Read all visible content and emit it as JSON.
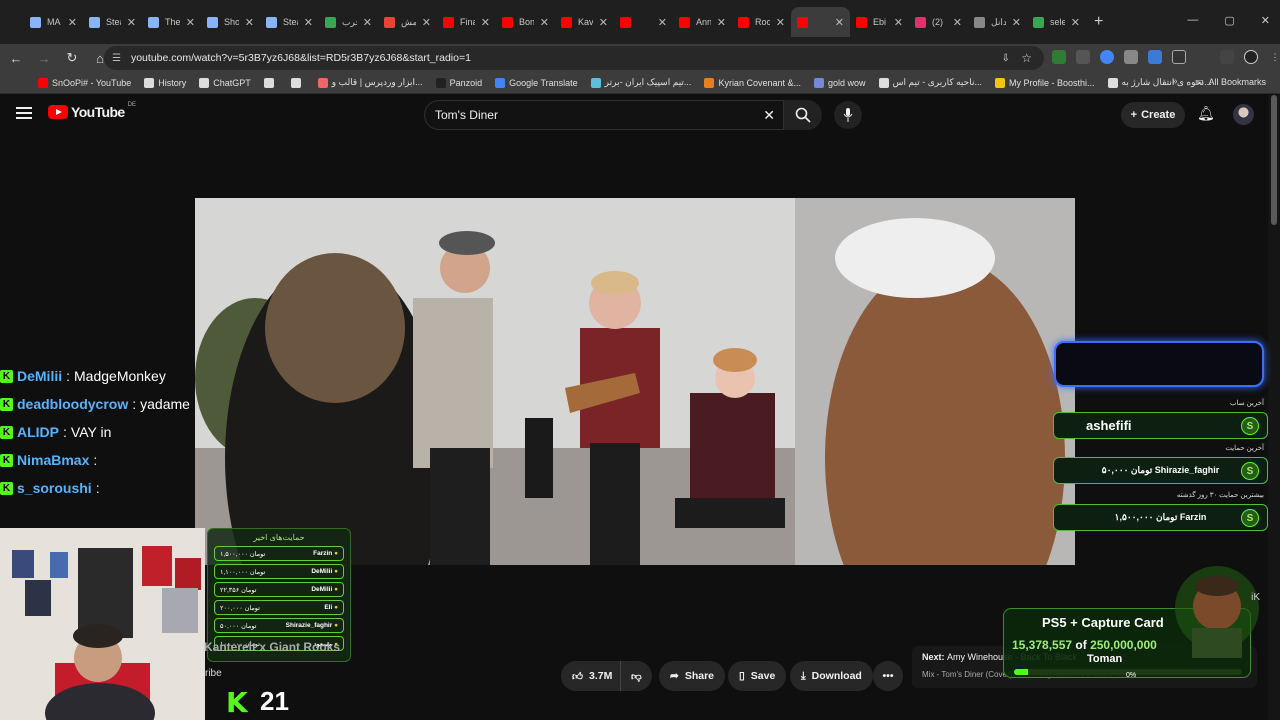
{
  "browser": {
    "tabs": [
      {
        "title": "MA",
        "color": "#8ab4f8"
      },
      {
        "title": "Stea",
        "color": "#8ab4f8"
      },
      {
        "title": "The",
        "color": "#8ab4f8"
      },
      {
        "title": "Sho",
        "color": "#8ab4f8"
      },
      {
        "title": "Stea",
        "color": "#8ab4f8"
      },
      {
        "title": "حرب",
        "color": "#34a853"
      },
      {
        "title": "مش",
        "color": "#ea4335"
      },
      {
        "title": "Fina",
        "color": "#ff0000"
      },
      {
        "title": "Bon",
        "color": "#ff0000"
      },
      {
        "title": "Kav",
        "color": "#ff0000"
      },
      {
        "title": "",
        "color": "#ff0000"
      },
      {
        "title": "Ann",
        "color": "#ff0000"
      },
      {
        "title": "Roc",
        "color": "#ff0000"
      },
      {
        "title": "",
        "color": "#ff0000",
        "active": true
      },
      {
        "title": "Ebi",
        "color": "#ff0000"
      },
      {
        "title": "(2)",
        "color": "#e1306c"
      },
      {
        "title": "دانل",
        "color": "#888888"
      },
      {
        "title": "sele",
        "color": "#34a853"
      }
    ],
    "url": "youtube.com/watch?v=5r3B7yz6J68&list=RD5r3B7yz6J68&start_radio=1",
    "bookmarks": [
      {
        "label": "SnOoPi# - YouTube",
        "color": "#ff0000"
      },
      {
        "label": "History",
        "color": "#dddddd"
      },
      {
        "label": "ChatGPT",
        "color": "#dddddd"
      },
      {
        "label": "",
        "color": "#dddddd"
      },
      {
        "label": "",
        "color": "#dddddd"
      },
      {
        "label": "ابزار وردپرس | قالب و...",
        "color": "#e66"
      },
      {
        "label": "Panzoid",
        "color": "#222"
      },
      {
        "label": "Google Translate",
        "color": "#4285f4"
      },
      {
        "label": "تیم اسپیک ایران -برتر...",
        "color": "#5bc0de"
      },
      {
        "label": "Kyrian Covenant &...",
        "color": "#e67e22"
      },
      {
        "label": "gold wow",
        "color": "#7289da"
      },
      {
        "label": "ناحیه کاربری - تیم اس...",
        "color": "#dddddd"
      },
      {
        "label": "My Profile - Boosthi...",
        "color": "#f1c40f"
      },
      {
        "label": "نحوه ی انتقال شارژ به...",
        "color": "#dddddd"
      }
    ],
    "all_bookmarks": "All Bookmarks"
  },
  "youtube": {
    "logo_text": "YouTube",
    "country": "DE",
    "search_value": "Tom's Diner",
    "create_label": "Create",
    "likes": "3.7M",
    "share_label": "Share",
    "save_label": "Save",
    "download_label": "Download",
    "next_prefix": "Next:",
    "next_title": "Amy Winehouse - Back To Black",
    "next_sub": "Mix - Tom's Diner (Cover) AnnenMayKantereit x Giant Rooks",
    "next_pct": "0%"
  },
  "stream": {
    "chat": [
      {
        "user": "DeMilii",
        "msg": "MadgeMonkey"
      },
      {
        "user": "deadbloodycrow",
        "msg": "yadame"
      },
      {
        "user": "ALIDP",
        "msg": "VAY in"
      },
      {
        "user": "NimaBmax",
        "msg": ""
      },
      {
        "user": "s_soroushi",
        "msg": ""
      }
    ],
    "support_title": "حمایت‌های اخیر",
    "supports": [
      {
        "name": "Farzin",
        "amount": "۱,۵۰۰,۰۰۰ تومان"
      },
      {
        "name": "DeMilii",
        "amount": "۱,۱۰۰,۰۰۰ تومان"
      },
      {
        "name": "DeMilii",
        "amount": "۲۲,۳۵۶ تومان"
      },
      {
        "name": "Eli",
        "amount": "۲۰۰,۰۰۰ تومان"
      },
      {
        "name": "Shirazie_faghir",
        "amount": "۵۰,۰۰۰ تومان"
      },
      {
        "name": "مسعود",
        "amount": "۱۰۰,۰۰۰ تومان"
      }
    ],
    "scroller_text": "Kanterelt x Giant Rooks",
    "ribe_text": "ribe",
    "kick_icon": "K",
    "viewer_count": "21",
    "last_sub_label": "آخرین ساب",
    "last_sub": "ashefifi",
    "last_support_label": "آخرین حمایت",
    "last_support": "۵۰,۰۰۰ تومان Shirazie_faghir",
    "top_support_label": "بیشترین حمایت ۳۰ روز گذشته",
    "top_support": "۱,۵۰۰,۰۰۰ تومان Farzin",
    "card_icon": "S",
    "goal_title": "PS5 + Capture Card",
    "goal_current": "15,378,557",
    "goal_of": "of",
    "goal_target": "250,000,000",
    "goal_unit": "Toman",
    "goal_progress": 0.0615,
    "char_tag": "iK"
  }
}
